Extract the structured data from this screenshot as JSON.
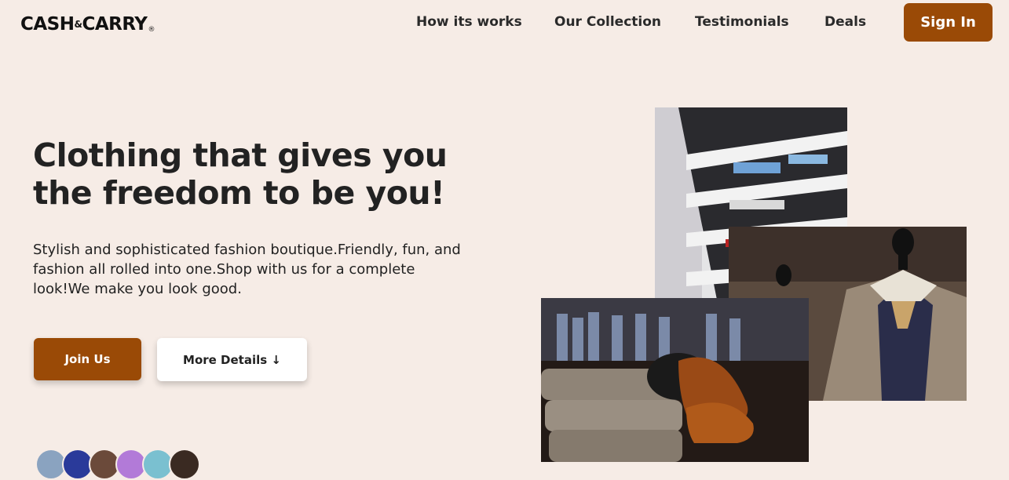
{
  "header": {
    "logo_main": "CASH",
    "logo_amp": "&",
    "logo_tail": "CARRY",
    "logo_reg": "®",
    "nav": [
      {
        "label": "How its works"
      },
      {
        "label": "Our Collection"
      },
      {
        "label": "Testimonials"
      },
      {
        "label": "Deals"
      }
    ],
    "signin_label": "Sign In"
  },
  "hero": {
    "title": "Clothing that gives you the freedom to be you!",
    "description": "Stylish and sophisticated fashion boutique.Friendly, fun, and fashion all rolled into one.Shop with us for a complete look!We make you look good.",
    "join_label": "Join Us",
    "more_label": "More Details ↓"
  },
  "avatars": {
    "colors": [
      "#8aa3c0",
      "#2a3a9a",
      "#6b4a3a",
      "#b27ad8",
      "#7ac0d0",
      "#3a2a22"
    ]
  },
  "images": {
    "shelves": "store-shelves-image",
    "mannequin": "mannequin-jacket-image",
    "shoes": "shoes-and-sweaters-image"
  },
  "colors": {
    "brand": "#9a4a06",
    "background": "#f6ece6"
  }
}
